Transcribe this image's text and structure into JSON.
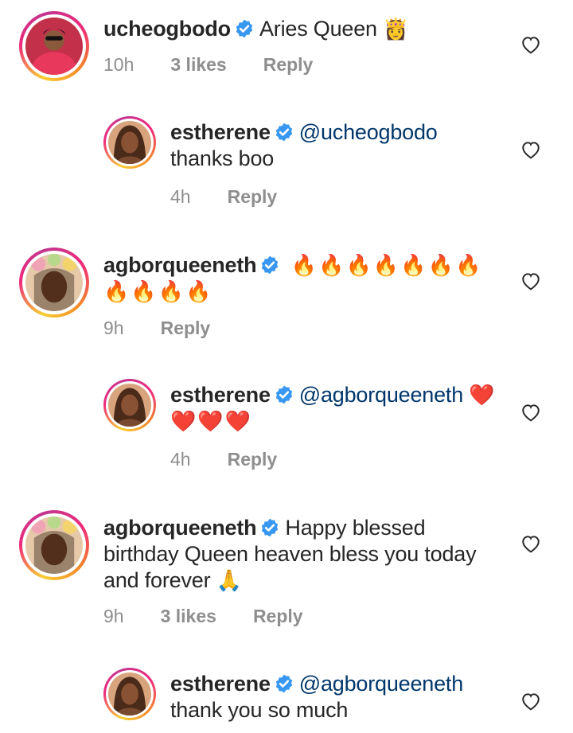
{
  "comments": [
    {
      "username": "ucheogbodo",
      "text": "Aries Queen",
      "emoji": "👸",
      "time": "10h",
      "likes": "3 likes",
      "reply": "Reply",
      "avatar": "avatar-uche"
    },
    {
      "username": "estherene",
      "mention": "@ucheogbodo",
      "text": " thanks boo",
      "time": "4h",
      "reply": "Reply",
      "avatar": "avatar-esther"
    },
    {
      "username": "agborqueeneth",
      "emoji": "🔥🔥🔥🔥🔥🔥🔥 🔥🔥🔥🔥",
      "time": "9h",
      "reply": "Reply",
      "avatar": "avatar-agbor"
    },
    {
      "username": "estherene",
      "mention": "@agborqueeneth",
      "emoji": "❤️❤️❤️❤️",
      "time": "4h",
      "reply": "Reply",
      "avatar": "avatar-esther"
    },
    {
      "username": "agborqueeneth",
      "text": "Happy blessed birthday Queen heaven bless you today and forever",
      "emoji": "🙏",
      "time": "9h",
      "likes": "3 likes",
      "reply": "Reply",
      "avatar": "avatar-agbor"
    },
    {
      "username": "estherene",
      "mention": "@agborqueeneth",
      "text": "thank you so much",
      "avatar": "avatar-esther"
    }
  ],
  "colors": {
    "verified": "#3897f0",
    "mention": "#00376b",
    "meta": "#8e8e8e"
  }
}
